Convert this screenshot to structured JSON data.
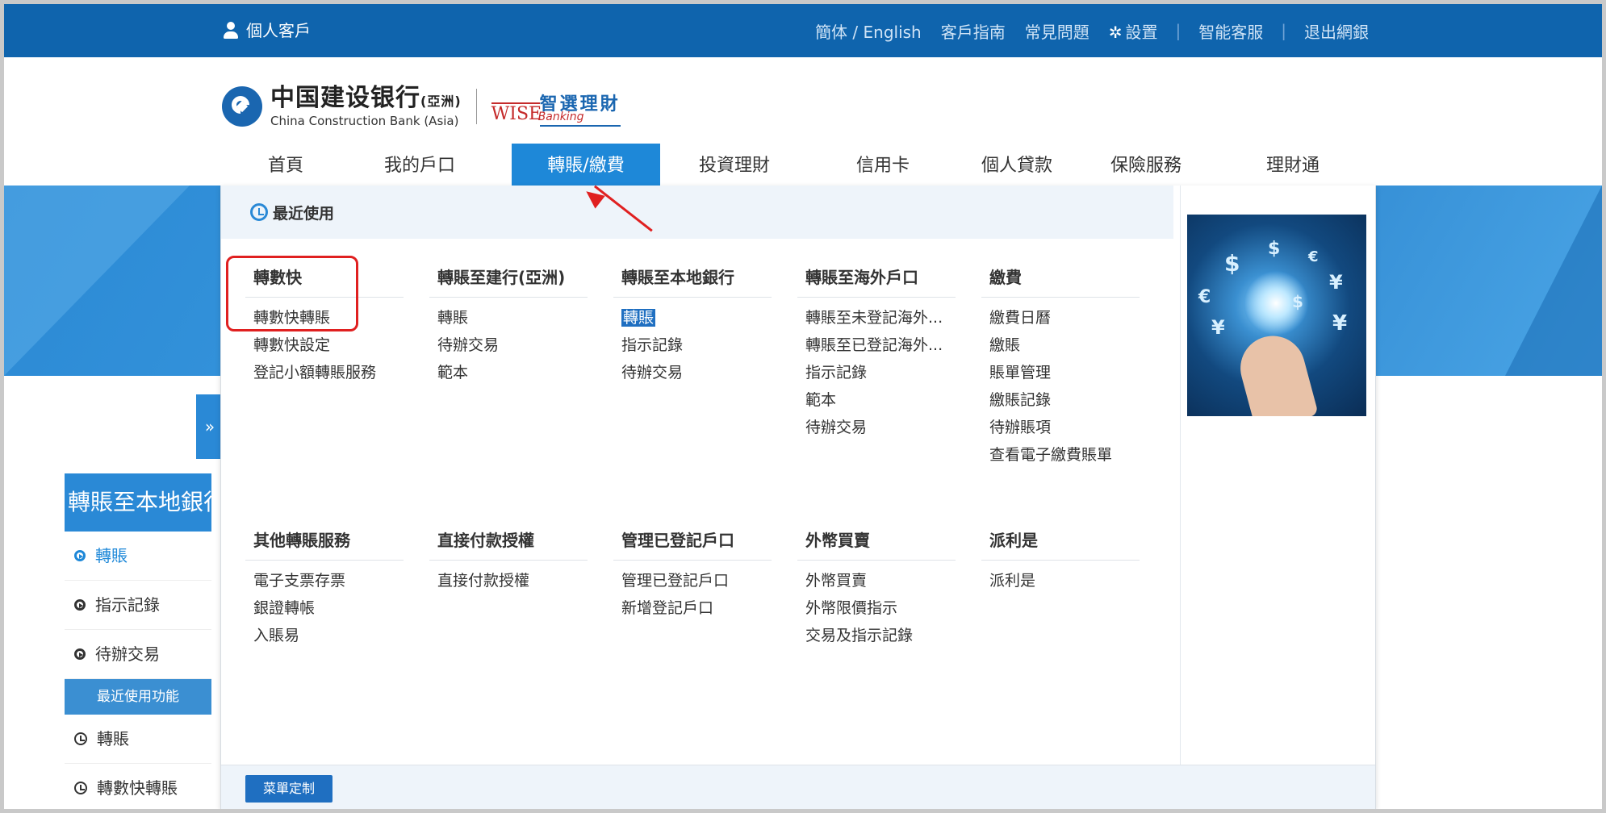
{
  "topbar": {
    "personal_label": "個人客戶",
    "nav": [
      "簡体 / English",
      "客戶指南",
      "常見問題",
      "設置",
      "智能客服",
      "退出網銀"
    ]
  },
  "header": {
    "logo_cn": "中国建设银行",
    "logo_cn_suffix": "(亞洲)",
    "logo_en": "China Construction Bank (Asia)",
    "wise_cn": "智選理財",
    "wise_en": "WISE",
    "wise_sub": "Banking"
  },
  "mainnav": {
    "items": [
      "首頁",
      "我的戶口",
      "轉賬/繳費",
      "投資理財",
      "信用卡",
      "個人貸款",
      "保險服務",
      "理財通"
    ]
  },
  "sidebar": {
    "expand_icon": "»",
    "title": "轉賬至本地銀行",
    "items": [
      "轉賬",
      "指示記錄",
      "待辦交易"
    ],
    "recent_title": "最近使用功能",
    "recent_items": [
      "轉賬",
      "轉數快轉賬"
    ]
  },
  "menu": {
    "recent_heading": "最近使用",
    "columns": [
      {
        "heading": "轉數快",
        "links": [
          "轉數快轉賬",
          "轉數快設定",
          "登記小額轉賬服務"
        ]
      },
      {
        "heading": "轉賬至建行(亞洲)",
        "links": [
          "轉賬",
          "待辦交易",
          "範本"
        ]
      },
      {
        "heading": "轉賬至本地銀行",
        "links": [
          "轉賬",
          "指示記錄",
          "待辦交易"
        ]
      },
      {
        "heading": "轉賬至海外戶口",
        "links": [
          "轉賬至未登記海外...",
          "轉賬至已登記海外...",
          "指示記錄",
          "範本",
          "待辦交易"
        ]
      },
      {
        "heading": "繳費",
        "links": [
          "繳費日曆",
          "繳賬",
          "賬單管理",
          "繳賬記錄",
          "待辦賬項",
          "查看電子繳費賬單"
        ]
      },
      {
        "heading": "其他轉賬服務",
        "links": [
          "電子支票存票",
          "銀證轉帳",
          "入賬易"
        ]
      },
      {
        "heading": "直接付款授權",
        "links": [
          "直接付款授權"
        ]
      },
      {
        "heading": "管理已登記戶口",
        "links": [
          "管理已登記戶口",
          "新增登記戶口"
        ]
      },
      {
        "heading": "外幣買賣",
        "links": [
          "外幣買賣",
          "外幣限價指示",
          "交易及指示記錄"
        ]
      },
      {
        "heading": "派利是",
        "links": [
          "派利是"
        ]
      }
    ],
    "customize_button": "菜單定制"
  },
  "colors": {
    "topbar": "#0f64ad",
    "accent": "#1e88d8",
    "highlight": "#1f6fc1",
    "annotation": "#e02020"
  }
}
